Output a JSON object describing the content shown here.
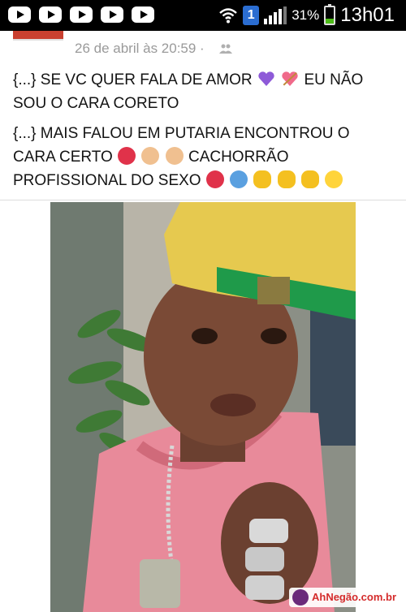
{
  "status_bar": {
    "app_icons": [
      "youtube-icon",
      "youtube-icon",
      "youtube-icon",
      "youtube-icon",
      "youtube-icon"
    ],
    "notification_count": "1",
    "battery_percent": "31%",
    "battery_level": 0.31,
    "time": "13h01"
  },
  "post": {
    "timestamp": "26 de abril às 20:59 ·",
    "privacy_icon": "friends-icon",
    "paragraphs": {
      "p1_a": "{...} SE VC QUER FALA DE AMOR",
      "p1_b": "EU NÃO SOU O CARA CORETO",
      "p2_a": "{...} MAIS FALOU EM PUTARIA ENCONTROU O CARA CERTO",
      "p2_b": "CACHORRÃO PROFISSIONAL DO SEXO"
    }
  },
  "photo": {
    "watermark": "AhNegão.com.br"
  },
  "colors": {
    "status_bar_bg": "#000000",
    "timestamp_text": "#9a9a9a",
    "watermark_text": "#d42b2b",
    "battery_fill": "#4cbb17"
  }
}
